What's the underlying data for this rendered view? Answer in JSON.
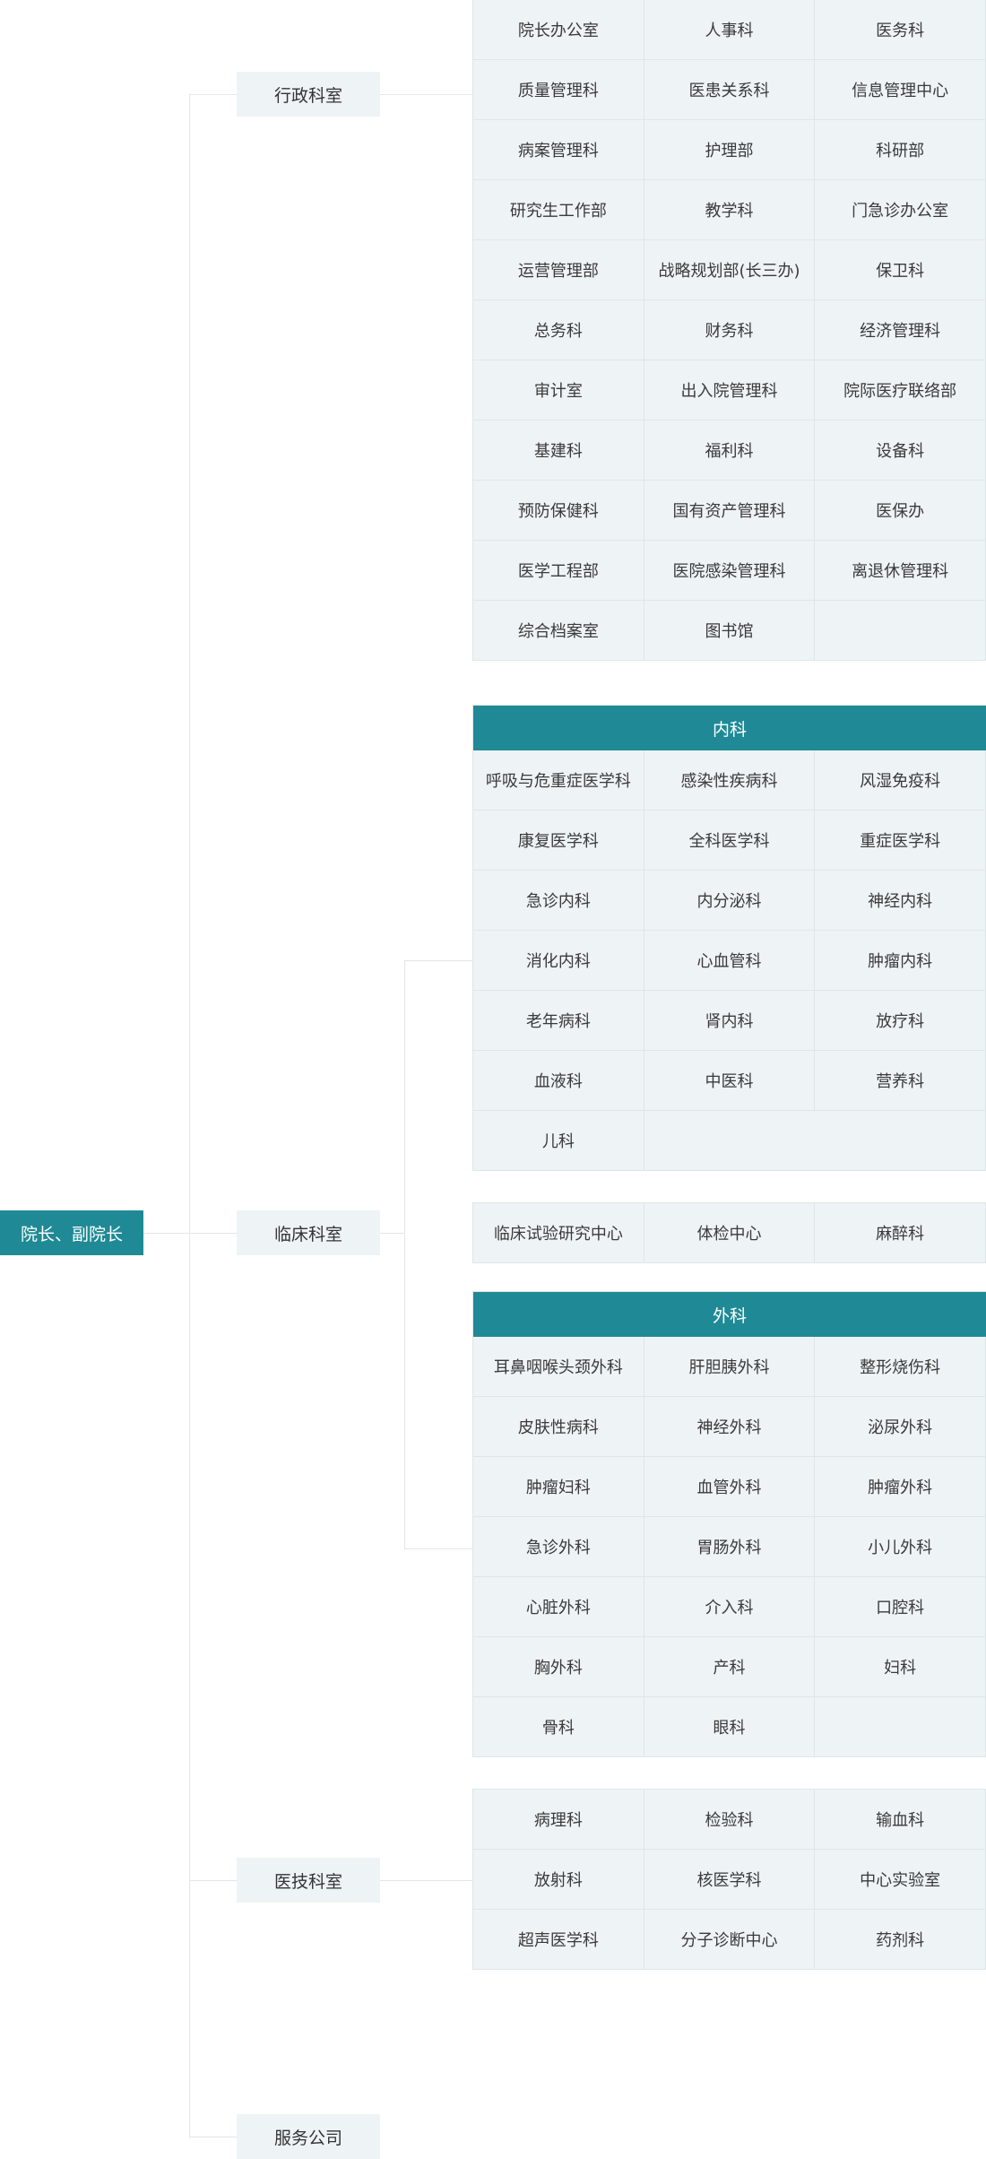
{
  "root": {
    "label": "院长、副院长"
  },
  "branches": {
    "admin": {
      "label": "行政科室",
      "items": [
        "院长办公室",
        "人事科",
        "医务科",
        "质量管理科",
        "医患关系科",
        "信息管理中心",
        "病案管理科",
        "护理部",
        "科研部",
        "研究生工作部",
        "教学科",
        "门急诊办公室",
        "运营管理部",
        "战略规划部(长三办)",
        "保卫科",
        "总务科",
        "财务科",
        "经济管理科",
        "审计室",
        "出入院管理科",
        "院际医疗联络部",
        "基建科",
        "福利科",
        "设备科",
        "预防保健科",
        "国有资产管理科",
        "医保办",
        "医学工程部",
        "医院感染管理科",
        "离退休管理科",
        "综合档案室",
        "图书馆",
        ""
      ]
    },
    "clinical": {
      "label": "临床科室",
      "internal": {
        "title": "内科",
        "items": [
          "呼吸与危重症医学科",
          "感染性疾病科",
          "风湿免疫科",
          "康复医学科",
          "全科医学科",
          "重症医学科",
          "急诊内科",
          "内分泌科",
          "神经内科",
          "消化内科",
          "心血管科",
          "肿瘤内科",
          "老年病科",
          "肾内科",
          "放疗科",
          "血液科",
          "中医科",
          "营养科",
          "儿科",
          ""
        ]
      },
      "middle": {
        "items": [
          "临床试验研究中心",
          "体检中心",
          "麻醉科"
        ]
      },
      "surgery": {
        "title": "外科",
        "items": [
          "耳鼻咽喉头颈外科",
          "肝胆胰外科",
          "整形烧伤科",
          "皮肤性病科",
          "神经外科",
          "泌尿外科",
          "肿瘤妇科",
          "血管外科",
          "肿瘤外科",
          "急诊外科",
          "胃肠外科",
          "小儿外科",
          "心脏外科",
          "介入科",
          "口腔科",
          "胸外科",
          "产科",
          "妇科",
          "骨科",
          "眼科",
          ""
        ]
      }
    },
    "tech": {
      "label": "医技科室",
      "items": [
        "病理科",
        "检验科",
        "输血科",
        "放射科",
        "核医学科",
        "中心实验室",
        "超声医学科",
        "分子诊断中心",
        "药剂科"
      ]
    },
    "service": {
      "label": "服务公司"
    }
  }
}
